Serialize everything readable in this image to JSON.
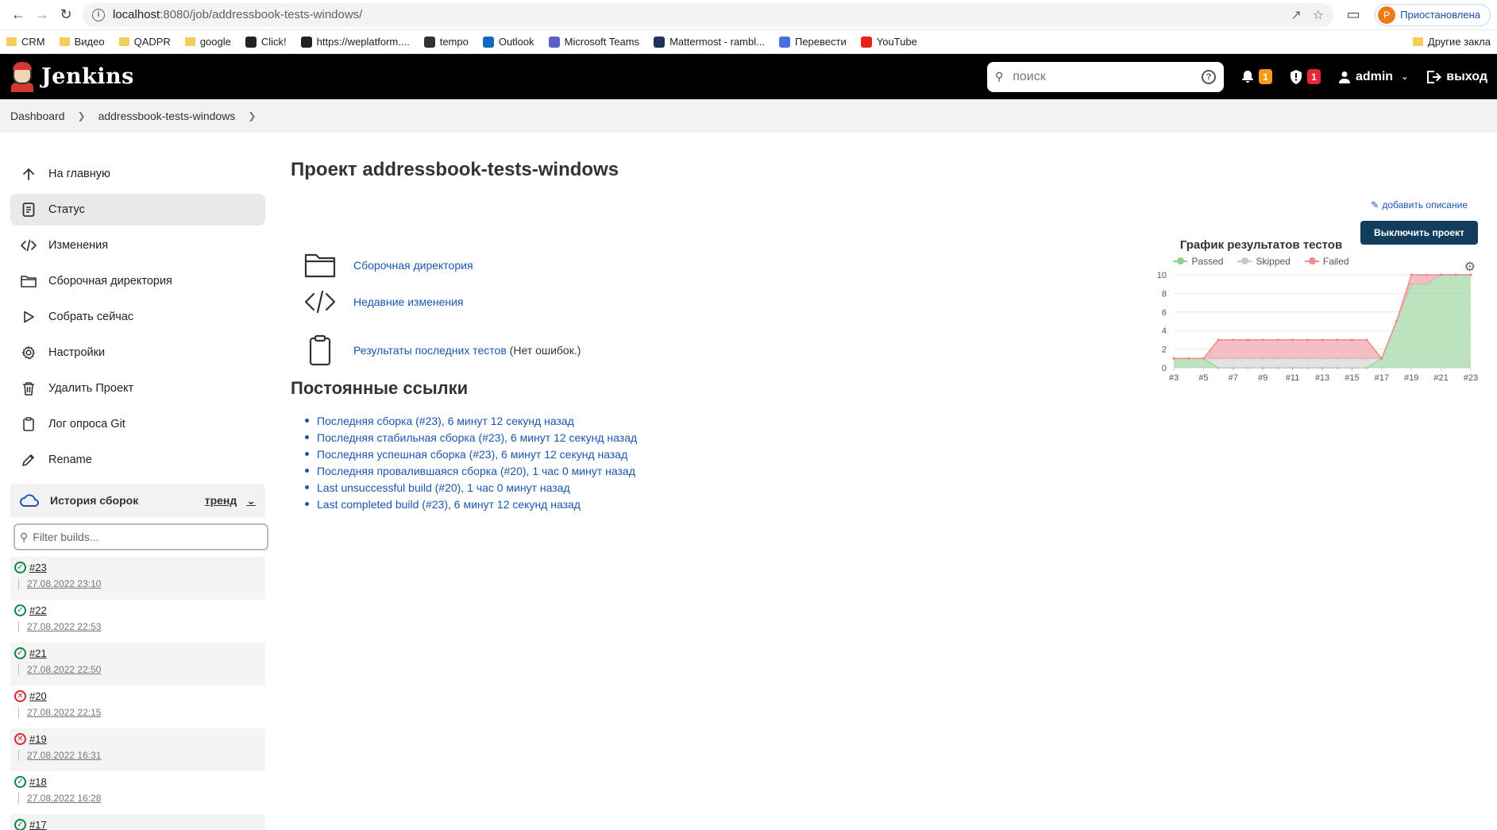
{
  "browser": {
    "url_host": "localhost",
    "url_rest": ":8080/job/addressbook-tests-windows/",
    "profile_initial": "P",
    "profile_label": "Приостановлена"
  },
  "bookmarks": [
    {
      "label": "CRM",
      "icon": "folder-icon"
    },
    {
      "label": "Видео",
      "icon": "folder-icon"
    },
    {
      "label": "QADPR",
      "icon": "folder-icon"
    },
    {
      "label": "google",
      "icon": "folder-icon"
    },
    {
      "label": "Click!",
      "icon": "clickup-icon"
    },
    {
      "label": "https://weplatform....",
      "icon": "w-icon"
    },
    {
      "label": "tempo",
      "icon": "tempo-icon"
    },
    {
      "label": "Outlook",
      "icon": "outlook-icon"
    },
    {
      "label": "Microsoft Teams",
      "icon": "teams-icon"
    },
    {
      "label": "Mattermost - rambl...",
      "icon": "mattermost-icon"
    },
    {
      "label": "Перевести",
      "icon": "translate-icon"
    },
    {
      "label": "YouTube",
      "icon": "youtube-icon"
    }
  ],
  "other_bookmarks": "Другие закла",
  "header": {
    "title": "Jenkins",
    "search_placeholder": "поиск",
    "notifications_count": "1",
    "security_count": "1",
    "user": "admin",
    "logout": "выход"
  },
  "breadcrumb": [
    "Dashboard",
    "addressbook-tests-windows"
  ],
  "sidebar": {
    "items": [
      {
        "label": "На главную",
        "icon": "arrow-up-icon"
      },
      {
        "label": "Статус",
        "icon": "document-icon"
      },
      {
        "label": "Изменения",
        "icon": "code-icon"
      },
      {
        "label": "Сборочная директория",
        "icon": "folder-icon"
      },
      {
        "label": "Собрать сейчас",
        "icon": "play-icon"
      },
      {
        "label": "Настройки",
        "icon": "gear-icon"
      },
      {
        "label": "Удалить Проект",
        "icon": "trash-icon"
      },
      {
        "label": "Лог опроса Git",
        "icon": "clipboard-icon"
      },
      {
        "label": "Rename",
        "icon": "pencil-icon"
      }
    ],
    "history_title": "История сборок",
    "trend_label": "тренд",
    "filter_placeholder": "Filter builds...",
    "builds": [
      {
        "num": "#23",
        "date": "27.08.2022 23:10",
        "status": "success"
      },
      {
        "num": "#22",
        "date": "27.08.2022 22:53",
        "status": "success"
      },
      {
        "num": "#21",
        "date": "27.08.2022 22:50",
        "status": "success"
      },
      {
        "num": "#20",
        "date": "27.08.2022 22:15",
        "status": "failed"
      },
      {
        "num": "#19",
        "date": "27.08.2022 16:31",
        "status": "failed"
      },
      {
        "num": "#18",
        "date": "27.08.2022 16:28",
        "status": "success"
      },
      {
        "num": "#17",
        "date": "",
        "status": "success"
      }
    ]
  },
  "main": {
    "title": "Проект addressbook-tests-windows",
    "add_description": "добавить описание",
    "disable_button": "Выключить проект",
    "links": [
      {
        "label": "Сборочная директория",
        "note": "",
        "icon": "folder-icon"
      },
      {
        "label": "Недавние изменения",
        "note": "",
        "icon": "code-icon"
      },
      {
        "label": "Результаты последних тестов",
        "note": "(Нет ошибок.)",
        "icon": "clipboard-icon"
      }
    ],
    "permalinks_title": "Постоянные ссылки",
    "permalinks": [
      "Последняя сборка (#23), 6 минут 12 секунд назад",
      "Последняя стабильная сборка (#23), 6 минут 12 секунд назад",
      "Последняя успешная сборка (#23), 6 минут 12 секунд назад",
      "Последняя провалившаяся сборка (#20), 1 час 0 минут назад",
      "Last unsuccessful build (#20), 1 час 0 минут назад",
      "Last completed build (#23), 6 минут 12 секунд назад"
    ]
  },
  "chart_data": {
    "type": "area",
    "title": "График результатов тестов",
    "x": [
      "#3",
      "#4",
      "#5",
      "#6",
      "#7",
      "#8",
      "#9",
      "#10",
      "#11",
      "#12",
      "#13",
      "#14",
      "#15",
      "#16",
      "#17",
      "#18",
      "#19",
      "#20",
      "#21",
      "#22",
      "#23"
    ],
    "xticks": [
      "#3",
      "#5",
      "#7",
      "#9",
      "#11",
      "#13",
      "#15",
      "#17",
      "#19",
      "#21",
      "#23"
    ],
    "ylim": [
      0,
      10
    ],
    "yticks": [
      0,
      2,
      4,
      6,
      8,
      10
    ],
    "stacked": true,
    "grid": true,
    "legend_position": "top",
    "series": [
      {
        "name": "Passed",
        "color": "#9fd6a3",
        "values": [
          1,
          1,
          1,
          0,
          0,
          0,
          0,
          0,
          0,
          0,
          0,
          0,
          0,
          0,
          1,
          5,
          9,
          9,
          10,
          10,
          10
        ]
      },
      {
        "name": "Skipped",
        "color": "#d6d6d6",
        "values": [
          0,
          0,
          0,
          1,
          1,
          1,
          1,
          1,
          1,
          1,
          1,
          1,
          1,
          1,
          0,
          0,
          0,
          0,
          0,
          0,
          0
        ]
      },
      {
        "name": "Failed",
        "color": "#f0a3a8",
        "values": [
          0,
          0,
          0,
          2,
          2,
          2,
          2,
          2,
          2,
          2,
          2,
          2,
          2,
          2,
          0,
          0,
          1,
          1,
          0,
          0,
          0
        ]
      }
    ]
  }
}
